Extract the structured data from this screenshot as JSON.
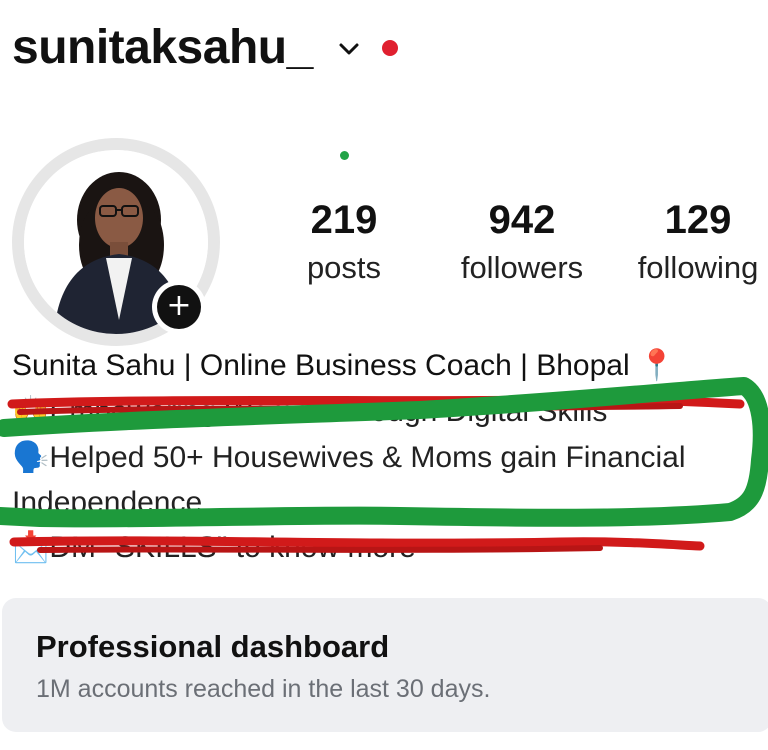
{
  "header": {
    "username": "sunitaksahu_",
    "account_switch_icon": "chevron-down-icon",
    "notification_dot_color": "#e0202f"
  },
  "avatar": {
    "add_story_icon": "plus-icon",
    "add_story_label": "+"
  },
  "stats": [
    {
      "value": "219",
      "label": "posts"
    },
    {
      "value": "942",
      "label": "followers"
    },
    {
      "value": "129",
      "label": "following"
    }
  ],
  "bio": {
    "name_line": "Sunita Sahu | Online Business Coach | Bhopal",
    "name_emoji": "📍",
    "line1_emoji": "🙌",
    "line1_text": "Empowering Women through Digital Skills",
    "line2_emoji": "🗣️",
    "line2_text": "Helped 50+ Housewives & Moms gain Financial",
    "line3_text": "Independence",
    "line4_emoji": "📩",
    "line4_text": "DM \"SKILLS\" to know more"
  },
  "dashboard": {
    "title": "Professional dashboard",
    "subtitle": "1M accounts reached in the last 30 days."
  },
  "colors": {
    "scribble_green": "#1e9a3c",
    "scribble_red": "#d11a1a",
    "online_dot": "#22a447"
  }
}
